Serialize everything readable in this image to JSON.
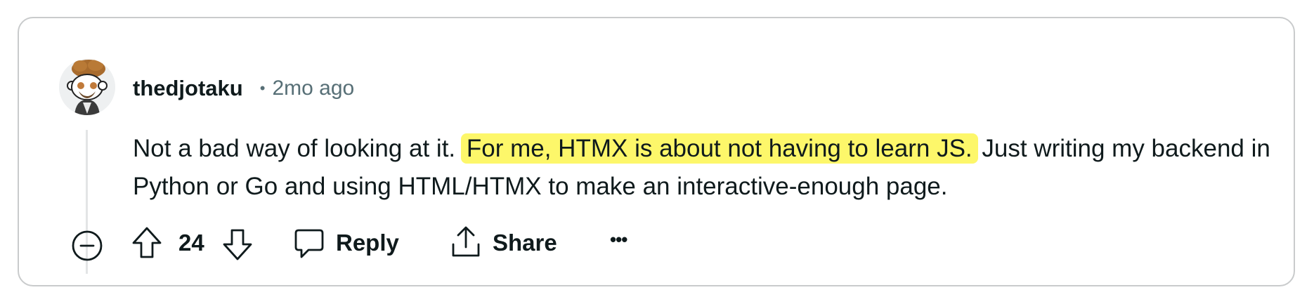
{
  "comment": {
    "username": "thedjotaku",
    "separator": "•",
    "timestamp": "2mo ago",
    "text_before": "Not a bad way of looking at it.",
    "text_highlighted": "For me, HTMX is about not having to learn JS.",
    "text_after": "Just writing my backend in Python or Go and using HTML/HTMX to make an interactive-enough page.",
    "highlight_color": "#fdf76a"
  },
  "actions": {
    "collapse_icon": "minus-circle-icon",
    "upvote_icon": "arrow-up-icon",
    "vote_count": "24",
    "downvote_icon": "arrow-down-icon",
    "reply_icon": "speech-bubble-icon",
    "reply_label": "Reply",
    "share_icon": "share-icon",
    "share_label": "Share",
    "more_label": "•••"
  },
  "colors": {
    "text": "#0f1a1c",
    "muted": "#576f76",
    "border": "#c9cbcc"
  }
}
